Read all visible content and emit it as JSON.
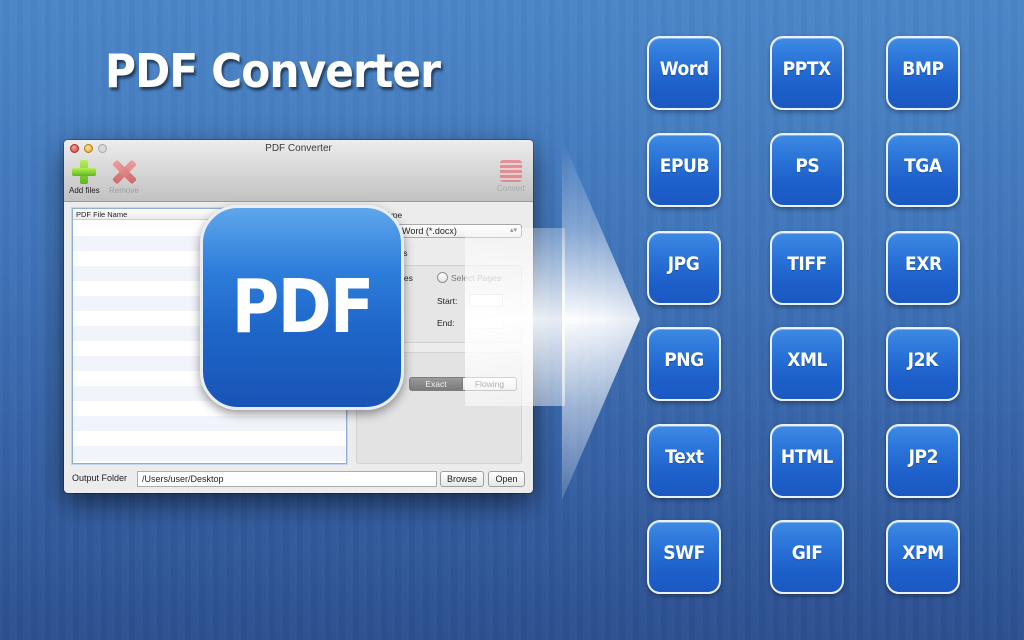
{
  "hero": {
    "title": "PDF Converter"
  },
  "window": {
    "title": "PDF Converter",
    "toolbar": {
      "add_files": "Add files",
      "remove": "Remove",
      "convert": "Convert"
    },
    "file_list": {
      "column_header": "PDF File Name",
      "rows": []
    },
    "options": {
      "output_type_label": "Output Type",
      "output_type_value": "Microsoft Word (*.docx)",
      "page_ranges_label": "Page Ranges",
      "all_pages_label": "All Pages",
      "select_pages_label": "Select Pages",
      "start_label": "Start:",
      "end_label": "End:",
      "mode_active": "Exact",
      "mode_inactive": "Flowing"
    },
    "output": {
      "label": "Output Folder",
      "path": "/Users/user/Desktop",
      "browse": "Browse",
      "open": "Open"
    }
  },
  "badge": {
    "label": "PDF"
  },
  "formats": [
    "Word",
    "PPTX",
    "BMP",
    "EPUB",
    "PS",
    "TGA",
    "JPG",
    "TIFF",
    "EXR",
    "PNG",
    "XML",
    "J2K",
    "Text",
    "HTML",
    "JP2",
    "SWF",
    "GIF",
    "XPM"
  ]
}
